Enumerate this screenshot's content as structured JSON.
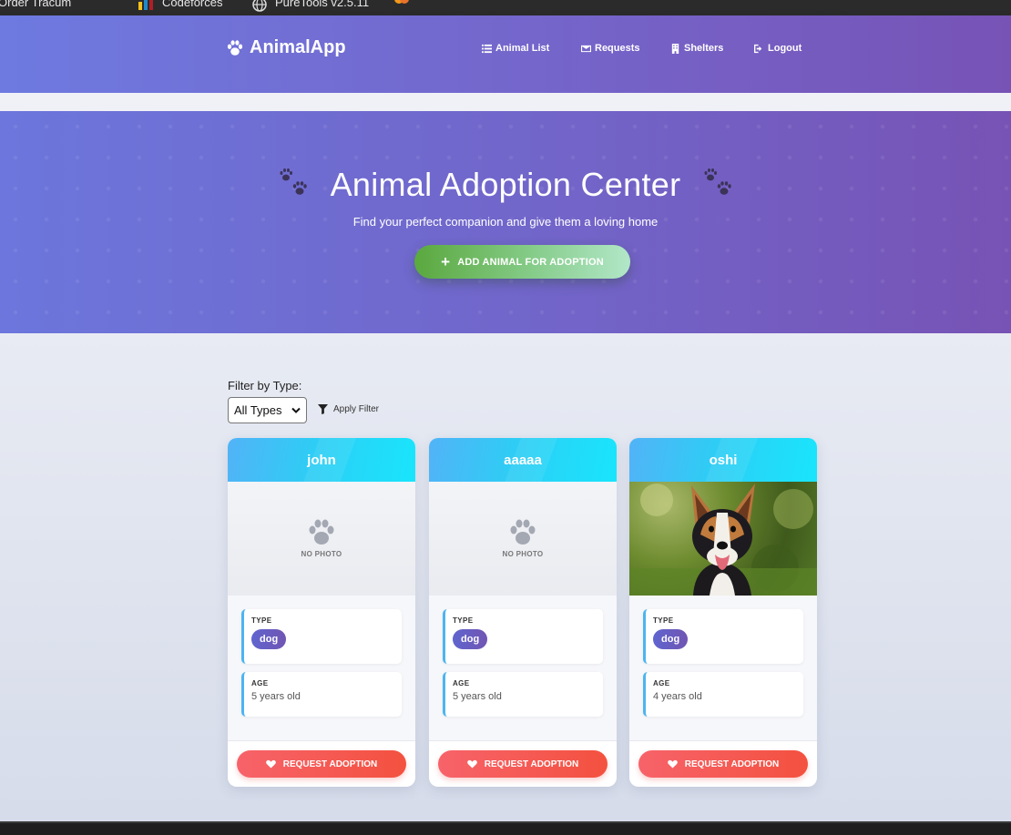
{
  "browser": {
    "bookmarks": [
      {
        "label": "Order Tracum",
        "icon": "order-icon"
      },
      {
        "label": "Codeforces",
        "icon": "codeforces-icon"
      },
      {
        "label": "PureTools v2.5.11",
        "icon": "globe-icon"
      }
    ]
  },
  "nav": {
    "brand": "AnimalApp",
    "links": [
      {
        "label": "Animal List",
        "icon": "list-icon"
      },
      {
        "label": "Requests",
        "icon": "envelope-icon"
      },
      {
        "label": "Shelters",
        "icon": "building-icon"
      },
      {
        "label": "Logout",
        "icon": "logout-icon"
      }
    ]
  },
  "hero": {
    "title": "Animal Adoption Center",
    "subtitle": "Find your perfect companion and give them a loving home",
    "add_button": "ADD ANIMAL FOR ADOPTION"
  },
  "filter": {
    "label": "Filter by Type:",
    "selected": "All Types",
    "apply_label": "Apply Filter"
  },
  "labels": {
    "no_photo": "NO PHOTO",
    "type": "TYPE",
    "age": "AGE",
    "request_button": "REQUEST ADOPTION"
  },
  "animals": [
    {
      "name": "john",
      "type": "dog",
      "age": "5 years old",
      "has_photo": false
    },
    {
      "name": "aaaaa",
      "type": "dog",
      "age": "5 years old",
      "has_photo": false
    },
    {
      "name": "oshi",
      "type": "dog",
      "age": "4 years old",
      "has_photo": true
    }
  ],
  "colors": {
    "nav_gradient_start": "#6e7ae0",
    "nav_gradient_end": "#7753b6",
    "card_header": "#2ecdf5",
    "request_button": "#f4513f",
    "add_button": "#5aa83e",
    "type_badge": "#6660c8"
  }
}
